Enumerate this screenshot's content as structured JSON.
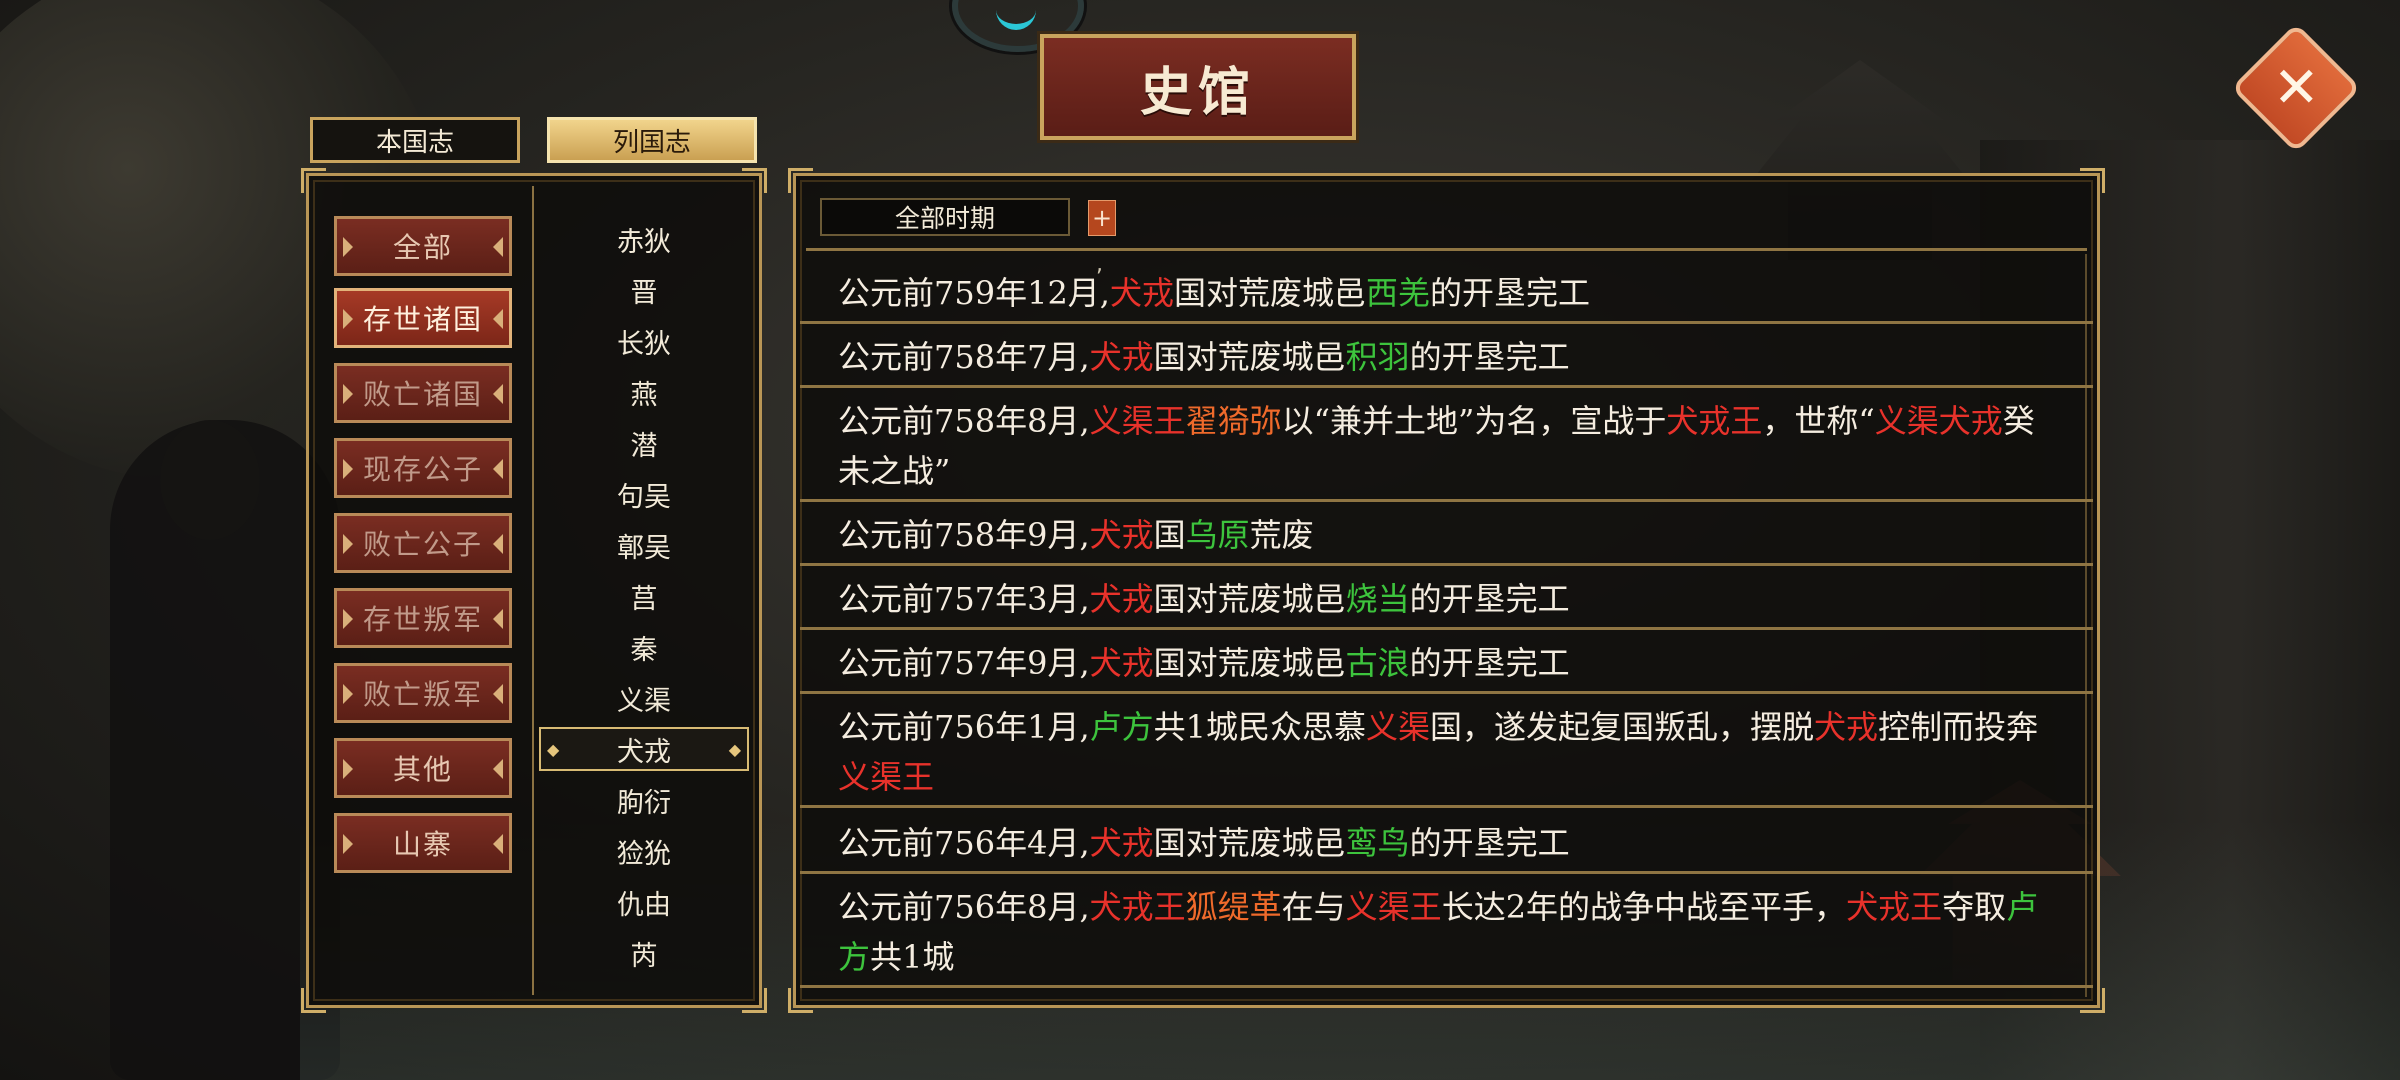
{
  "title": "史馆",
  "close_label": "✕",
  "tabs": {
    "local": "本国志",
    "nations": "列国志"
  },
  "categories": [
    {
      "label": "全部",
      "state": "normal"
    },
    {
      "label": "存世诸国",
      "state": "active"
    },
    {
      "label": "败亡诸国",
      "state": "dim"
    },
    {
      "label": "现存公子",
      "state": "dim"
    },
    {
      "label": "败亡公子",
      "state": "dim"
    },
    {
      "label": "存世叛军",
      "state": "dim"
    },
    {
      "label": "败亡叛军",
      "state": "dim"
    },
    {
      "label": "其他",
      "state": "normal"
    },
    {
      "label": "山寨",
      "state": "normal"
    }
  ],
  "nations": [
    "赤狄",
    "晋",
    "长狄",
    "燕",
    "潜",
    "句吴",
    "鄣吴",
    "莒",
    "秦",
    "义渠",
    "犬戎",
    "朐衍",
    "猃狁",
    "仇由",
    "芮"
  ],
  "selected_nation_index": 10,
  "period": {
    "label": "全部时期",
    "add_label": "+"
  },
  "log_stub": ",",
  "colors": {
    "accent_red": "#e8322b",
    "accent_orange": "#ef6a2b",
    "accent_green": "#3dc43d",
    "frame_gold": "#b99656"
  },
  "entries": [
    [
      [
        "w",
        "公元前759年12月,"
      ],
      [
        "r",
        "犬戎"
      ],
      [
        "w",
        "国对荒废城邑"
      ],
      [
        "g",
        "西羌"
      ],
      [
        "w",
        "的开垦完工"
      ]
    ],
    [
      [
        "w",
        "公元前758年7月,"
      ],
      [
        "r",
        "犬戎"
      ],
      [
        "w",
        "国对荒废城邑"
      ],
      [
        "g",
        "积羽"
      ],
      [
        "w",
        "的开垦完工"
      ]
    ],
    [
      [
        "w",
        "公元前758年8月,"
      ],
      [
        "r",
        "义渠王"
      ],
      [
        "o",
        "翟猗弥"
      ],
      [
        "w",
        "以“兼并土地”为名，宣战于"
      ],
      [
        "r",
        "犬戎王"
      ],
      [
        "w",
        "，世称“"
      ],
      [
        "r",
        "义渠犬戎"
      ],
      [
        "w",
        "癸未之战”"
      ]
    ],
    [
      [
        "w",
        "公元前758年9月,"
      ],
      [
        "r",
        "犬戎"
      ],
      [
        "w",
        "国"
      ],
      [
        "g",
        "乌原"
      ],
      [
        "w",
        "荒废"
      ]
    ],
    [
      [
        "w",
        "公元前757年3月,"
      ],
      [
        "r",
        "犬戎"
      ],
      [
        "w",
        "国对荒废城邑"
      ],
      [
        "g",
        "烧当"
      ],
      [
        "w",
        "的开垦完工"
      ]
    ],
    [
      [
        "w",
        "公元前757年9月,"
      ],
      [
        "r",
        "犬戎"
      ],
      [
        "w",
        "国对荒废城邑"
      ],
      [
        "g",
        "古浪"
      ],
      [
        "w",
        "的开垦完工"
      ]
    ],
    [
      [
        "w",
        "公元前756年1月,"
      ],
      [
        "g",
        "卢方"
      ],
      [
        "w",
        "共1城民众思慕"
      ],
      [
        "r",
        "义渠"
      ],
      [
        "w",
        "国，遂发起复国叛乱，摆脱"
      ],
      [
        "r",
        "犬戎"
      ],
      [
        "w",
        "控制而投奔"
      ],
      [
        "r",
        "义渠王"
      ]
    ],
    [
      [
        "w",
        "公元前756年4月,"
      ],
      [
        "r",
        "犬戎"
      ],
      [
        "w",
        "国对荒废城邑"
      ],
      [
        "g",
        "鸾鸟"
      ],
      [
        "w",
        "的开垦完工"
      ]
    ],
    [
      [
        "w",
        "公元前756年8月,"
      ],
      [
        "r",
        "犬戎王"
      ],
      [
        "o",
        "狐缇革"
      ],
      [
        "w",
        "在与"
      ],
      [
        "r",
        "义渠王"
      ],
      [
        "w",
        "长达2年的战争中战至平手，"
      ],
      [
        "r",
        "犬戎王"
      ],
      [
        "w",
        "夺取"
      ],
      [
        "g",
        "卢方"
      ],
      [
        "w",
        "共1城"
      ]
    ]
  ]
}
